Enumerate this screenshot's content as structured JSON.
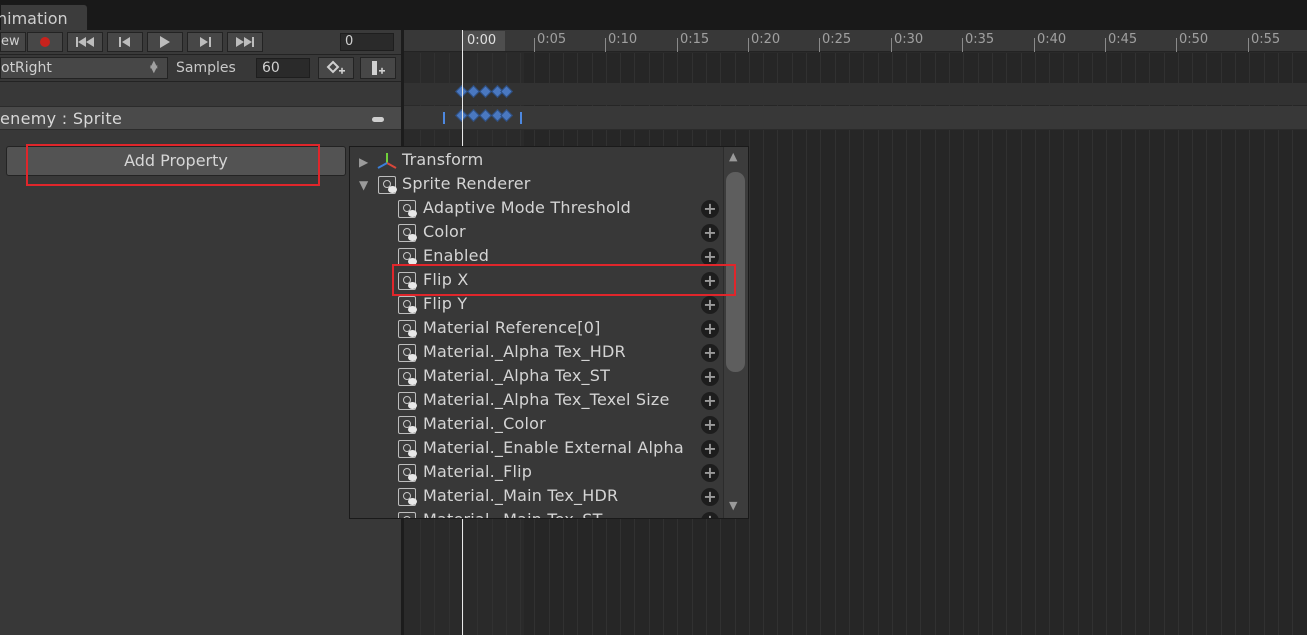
{
  "window": {
    "tab_label": "nimation"
  },
  "toolbar": {
    "preview_label": "ew",
    "frame_value": "0",
    "buttons": [
      "record-icon",
      "first-key-icon",
      "prev-key-icon",
      "play-icon",
      "next-key-icon",
      "last-key-icon"
    ]
  },
  "clip_row": {
    "clip_name": "otRight",
    "samples_label": "Samples",
    "samples_value": "60"
  },
  "property_row": {
    "label": "enemy : Sprite"
  },
  "add_property": {
    "label": "Add Property"
  },
  "timeline": {
    "ticks": [
      "0:00",
      "0:05",
      "0:10",
      "0:15",
      "0:20",
      "0:25",
      "0:30",
      "0:35",
      "0:40",
      "0:45",
      "0:50",
      "0:55"
    ]
  },
  "dropdown": {
    "groups": [
      {
        "label": "Transform",
        "expanded": false
      },
      {
        "label": "Sprite Renderer",
        "expanded": true
      }
    ],
    "items": [
      "Adaptive Mode Threshold",
      "Color",
      "Enabled",
      "Flip X",
      "Flip Y",
      "Material Reference[0]",
      "Material._Alpha Tex_HDR",
      "Material._Alpha Tex_ST",
      "Material._Alpha Tex_Texel Size",
      "Material._Color",
      "Material._Enable External Alpha",
      "Material._Flip",
      "Material._Main Tex_HDR",
      "Material._Main Tex_ST"
    ],
    "plus_symbol": "+",
    "highlighted_item": "Flip X"
  },
  "colors": {
    "highlight": "#e0262b",
    "keyframe": "#4a78c0",
    "record": "#c8221d"
  }
}
